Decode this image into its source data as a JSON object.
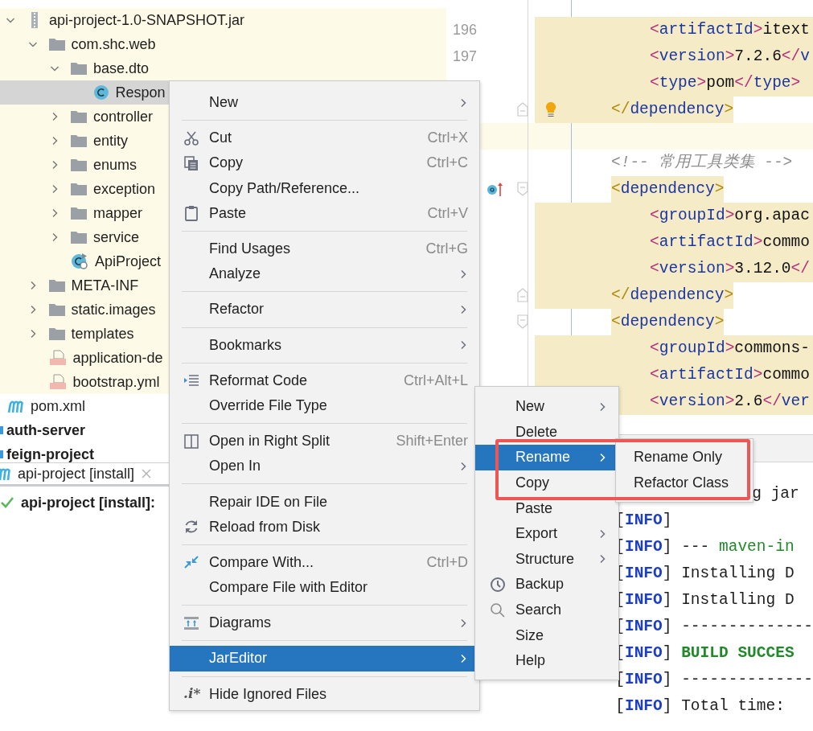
{
  "project_tree": [
    {
      "label": "api-project-1.0-SNAPSHOT.jar",
      "kind": "jar",
      "expanded": true,
      "selected": false,
      "children": [
        {
          "label": "com.shc.web",
          "kind": "folder",
          "expanded": true,
          "selected": false,
          "children": [
            {
              "label": "base.dto",
              "kind": "folder",
              "expanded": true,
              "selected": false,
              "children": [
                {
                  "label": "Respon",
                  "kind": "class",
                  "selected": true
                }
              ]
            },
            {
              "label": "controller",
              "kind": "folder",
              "expanded": false,
              "selected": false
            },
            {
              "label": "entity",
              "kind": "folder",
              "expanded": false,
              "selected": false
            },
            {
              "label": "enums",
              "kind": "folder",
              "expanded": false,
              "selected": false
            },
            {
              "label": "exception",
              "kind": "folder",
              "expanded": false,
              "selected": false
            },
            {
              "label": "mapper",
              "kind": "folder",
              "expanded": false,
              "selected": false
            },
            {
              "label": "service",
              "kind": "folder",
              "expanded": false,
              "selected": false
            },
            {
              "label": "ApiProject",
              "kind": "app-class",
              "selected": false
            }
          ]
        },
        {
          "label": "META-INF",
          "kind": "folder",
          "expanded": false,
          "selected": false
        },
        {
          "label": "static.images",
          "kind": "folder",
          "expanded": false,
          "selected": false
        },
        {
          "label": "templates",
          "kind": "folder",
          "expanded": false,
          "selected": false
        },
        {
          "label": "application-de",
          "kind": "yml",
          "selected": false
        },
        {
          "label": "bootstrap.yml",
          "kind": "yml",
          "selected": false
        }
      ]
    },
    {
      "label": "pom.xml",
      "kind": "maven",
      "selected": false
    },
    {
      "label": "auth-server",
      "kind": "module",
      "selected": false
    },
    {
      "label": "feign-project",
      "kind": "module",
      "selected": false
    }
  ],
  "editor": {
    "lines": [
      {
        "number": "196",
        "nested": true,
        "kind": "block",
        "parts": [
          {
            "kind": "bracket",
            "text": "<"
          },
          {
            "kind": "tag",
            "text": "artifactId"
          },
          {
            "kind": "bracket",
            "text": ">"
          },
          {
            "kind": "value",
            "text": "itext"
          }
        ]
      },
      {
        "number": "197",
        "nested": true,
        "kind": "block",
        "parts": [
          {
            "kind": "bracket",
            "text": "<"
          },
          {
            "kind": "tag",
            "text": "version"
          },
          {
            "kind": "bracket",
            "text": ">"
          },
          {
            "kind": "value",
            "text": "7.2.6"
          },
          {
            "kind": "bracket",
            "text": "</"
          },
          {
            "kind": "tag",
            "text": "v"
          }
        ]
      },
      {
        "nested": true,
        "kind": "block",
        "parts": [
          {
            "kind": "bracket",
            "text": "<"
          },
          {
            "kind": "tag",
            "text": "type"
          },
          {
            "kind": "bracket",
            "text": ">"
          },
          {
            "kind": "value",
            "text": "pom"
          },
          {
            "kind": "bracket",
            "text": "</"
          },
          {
            "kind": "tag",
            "text": "type"
          },
          {
            "kind": "bracket",
            "text": ">"
          }
        ]
      },
      {
        "nested": false,
        "kind": "close",
        "markers": [
          {
            "kind": "fold-end"
          },
          {
            "kind": "bulb"
          }
        ],
        "parts": [
          {
            "kind": "bracket",
            "text": "</"
          },
          {
            "kind": "tag",
            "text": "dependency"
          },
          {
            "kind": "bracket",
            "text": ">"
          }
        ]
      },
      {
        "kind": "caret"
      },
      {
        "nested": false,
        "kind": "none",
        "parts": [
          {
            "kind": "comment",
            "text": "<!-- 常用工具类集 -->"
          }
        ]
      },
      {
        "nested": false,
        "kind": "open",
        "markers": [
          {
            "kind": "override"
          },
          {
            "kind": "fold-start"
          }
        ],
        "parts": [
          {
            "kind": "bracket",
            "text": "<"
          },
          {
            "kind": "tag",
            "text": "dependency"
          },
          {
            "kind": "bracket",
            "text": ">"
          }
        ]
      },
      {
        "nested": true,
        "kind": "block",
        "parts": [
          {
            "kind": "bracket",
            "text": "<"
          },
          {
            "kind": "tag",
            "text": "groupId"
          },
          {
            "kind": "bracket",
            "text": ">"
          },
          {
            "kind": "value",
            "text": "org.apac"
          }
        ]
      },
      {
        "nested": true,
        "kind": "block",
        "parts": [
          {
            "kind": "bracket",
            "text": "<"
          },
          {
            "kind": "tag",
            "text": "artifactId"
          },
          {
            "kind": "bracket",
            "text": ">"
          },
          {
            "kind": "value",
            "text": "commo"
          }
        ]
      },
      {
        "nested": true,
        "kind": "block",
        "parts": [
          {
            "kind": "bracket",
            "text": "<"
          },
          {
            "kind": "tag",
            "text": "version"
          },
          {
            "kind": "bracket",
            "text": ">"
          },
          {
            "kind": "value",
            "text": "3.12.0"
          },
          {
            "kind": "bracket",
            "text": "</"
          }
        ]
      },
      {
        "nested": false,
        "kind": "close",
        "markers": [
          {
            "kind": "fold-end"
          }
        ],
        "parts": [
          {
            "kind": "bracket",
            "text": "</"
          },
          {
            "kind": "tag",
            "text": "dependency"
          },
          {
            "kind": "bracket",
            "text": ">"
          }
        ]
      },
      {
        "nested": false,
        "kind": "open",
        "markers": [
          {
            "kind": "fold-start"
          }
        ],
        "parts": [
          {
            "kind": "bracket",
            "text": "<"
          },
          {
            "kind": "tag",
            "text": "dependency"
          },
          {
            "kind": "bracket",
            "text": ">"
          }
        ]
      },
      {
        "nested": true,
        "kind": "block",
        "parts": [
          {
            "kind": "bracket",
            "text": "<"
          },
          {
            "kind": "tag",
            "text": "groupId"
          },
          {
            "kind": "bracket",
            "text": ">"
          },
          {
            "kind": "value",
            "text": "commons-"
          }
        ]
      },
      {
        "nested": true,
        "kind": "block",
        "parts": [
          {
            "kind": "bracket",
            "text": "<"
          },
          {
            "kind": "tag",
            "text": "artifactId"
          },
          {
            "kind": "bracket",
            "text": ">"
          },
          {
            "kind": "value",
            "text": "commo"
          }
        ]
      },
      {
        "nested": true,
        "kind": "block",
        "parts": [
          {
            "kind": "bracket",
            "text": "<"
          },
          {
            "kind": "tag",
            "text": "version"
          },
          {
            "kind": "bracket",
            "text": ">"
          },
          {
            "kind": "value",
            "text": "2.6"
          },
          {
            "kind": "bracket",
            "text": "</"
          },
          {
            "kind": "tag",
            "text": "ver"
          }
        ]
      }
    ]
  },
  "run_window": {
    "tab": {
      "label": "api-project [install]"
    },
    "tree": [
      {
        "label": "api-project [install]:",
        "kind": "success"
      }
    ]
  },
  "console": {
    "lines": [
      {
        "continued": true,
        "parts": [
          {
            "kind": "text",
            "text": "g jar"
          }
        ]
      },
      {
        "parts": [
          {
            "kind": "bracket",
            "text": "["
          },
          {
            "kind": "level",
            "text": "INFO"
          },
          {
            "kind": "bracket",
            "text": "]"
          }
        ]
      },
      {
        "parts": [
          {
            "kind": "bracket",
            "text": "["
          },
          {
            "kind": "level",
            "text": "INFO"
          },
          {
            "kind": "bracket",
            "text": "]"
          },
          {
            "kind": "text",
            "text": " --- "
          },
          {
            "kind": "green",
            "text": "maven-in"
          }
        ]
      },
      {
        "parts": [
          {
            "kind": "bracket",
            "text": "["
          },
          {
            "kind": "level",
            "text": "INFO"
          },
          {
            "kind": "bracket",
            "text": "]"
          },
          {
            "kind": "text",
            "text": " Installing D"
          }
        ]
      },
      {
        "parts": [
          {
            "kind": "bracket",
            "text": "["
          },
          {
            "kind": "level",
            "text": "INFO"
          },
          {
            "kind": "bracket",
            "text": "]"
          },
          {
            "kind": "text",
            "text": " Installing D"
          }
        ]
      },
      {
        "parts": [
          {
            "kind": "bracket",
            "text": "["
          },
          {
            "kind": "level",
            "text": "INFO"
          },
          {
            "kind": "bracket",
            "text": "]"
          },
          {
            "kind": "text",
            "text": " --------------"
          }
        ]
      },
      {
        "parts": [
          {
            "kind": "bracket",
            "text": "["
          },
          {
            "kind": "level",
            "text": "INFO"
          },
          {
            "kind": "bracket",
            "text": "]"
          },
          {
            "kind": "success",
            "text": " BUILD SUCCES"
          }
        ]
      },
      {
        "parts": [
          {
            "kind": "bracket",
            "text": "["
          },
          {
            "kind": "level",
            "text": "INFO"
          },
          {
            "kind": "bracket",
            "text": "]"
          },
          {
            "kind": "text",
            "text": " --------------"
          }
        ]
      },
      {
        "parts": [
          {
            "kind": "bracket",
            "text": "["
          },
          {
            "kind": "level",
            "text": "INFO"
          },
          {
            "kind": "bracket",
            "text": "]"
          },
          {
            "kind": "text",
            "text": " Total time:"
          }
        ]
      }
    ]
  },
  "context_menu": {
    "items": [
      {
        "label": "New",
        "submenu": true,
        "selected": false
      },
      {
        "kind": "separator"
      },
      {
        "kind": "scissors",
        "label": "Cut",
        "shortcut": "Ctrl+X",
        "submenu": false,
        "selected": false
      },
      {
        "kind": "copy",
        "label": "Copy",
        "shortcut": "Ctrl+C",
        "submenu": false,
        "selected": false
      },
      {
        "label": "Copy Path/Reference...",
        "submenu": false,
        "selected": false
      },
      {
        "kind": "clipboard",
        "label": "Paste",
        "shortcut": "Ctrl+V",
        "submenu": false,
        "selected": false
      },
      {
        "kind": "separator"
      },
      {
        "label": "Find Usages",
        "shortcut": "Ctrl+G",
        "submenu": false,
        "selected": false
      },
      {
        "label": "Analyze",
        "submenu": true,
        "selected": false
      },
      {
        "kind": "separator"
      },
      {
        "label": "Refactor",
        "submenu": true,
        "selected": false
      },
      {
        "kind": "separator"
      },
      {
        "label": "Bookmarks",
        "submenu": true,
        "selected": false
      },
      {
        "kind": "separator"
      },
      {
        "kind": "reformat",
        "label": "Reformat Code",
        "shortcut": "Ctrl+Alt+L",
        "submenu": false,
        "selected": false
      },
      {
        "label": "Override File Type",
        "submenu": false,
        "selected": false
      },
      {
        "kind": "separator"
      },
      {
        "kind": "split",
        "label": "Open in Right Split",
        "shortcut": "Shift+Enter",
        "submenu": false,
        "selected": false
      },
      {
        "label": "Open In",
        "submenu": true,
        "selected": false
      },
      {
        "kind": "separator"
      },
      {
        "label": "Repair IDE on File",
        "submenu": false,
        "selected": false
      },
      {
        "kind": "reload",
        "label": "Reload from Disk",
        "submenu": false,
        "selected": false
      },
      {
        "kind": "separator"
      },
      {
        "kind": "compare",
        "label": "Compare With...",
        "shortcut": "Ctrl+D",
        "submenu": false,
        "selected": false
      },
      {
        "label": "Compare File with Editor",
        "submenu": false,
        "selected": false
      },
      {
        "kind": "separator"
      },
      {
        "kind": "diagram",
        "label": "Diagrams",
        "submenu": true,
        "selected": false
      },
      {
        "kind": "separator"
      },
      {
        "label": "JarEditor",
        "submenu": true,
        "selected": true
      },
      {
        "kind": "separator"
      },
      {
        "kind": "glyph",
        "icon_text": ".i*",
        "label": "Hide Ignored Files",
        "submenu": false,
        "selected": false
      }
    ]
  },
  "submenu": {
    "items": [
      {
        "label": "New",
        "submenu": true,
        "selected": false
      },
      {
        "label": "Delete",
        "submenu": false,
        "selected": false
      },
      {
        "label": "Rename",
        "submenu": true,
        "selected": true
      },
      {
        "label": "Copy",
        "submenu": false,
        "selected": false
      },
      {
        "label": "Paste",
        "submenu": false,
        "selected": false
      },
      {
        "label": "Export",
        "submenu": true,
        "selected": false
      },
      {
        "label": "Structure",
        "submenu": true,
        "selected": false
      },
      {
        "kind": "clock",
        "label": "Backup",
        "submenu": false,
        "selected": false
      },
      {
        "kind": "search",
        "label": "Search",
        "submenu": false,
        "selected": false
      },
      {
        "label": "Size",
        "submenu": false,
        "selected": false
      },
      {
        "label": "Help",
        "submenu": false,
        "selected": false
      }
    ]
  },
  "rename_submenu": {
    "items": [
      {
        "label": "Rename Only",
        "submenu": false,
        "selected": false
      },
      {
        "label": "Refactor Class",
        "submenu": false,
        "selected": false
      }
    ]
  }
}
